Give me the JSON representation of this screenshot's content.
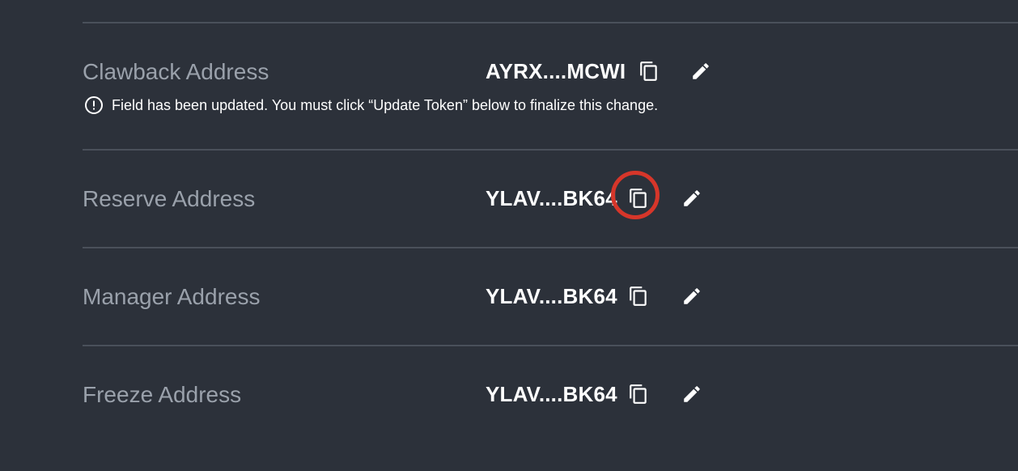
{
  "fields": [
    {
      "label": "Clawback Address",
      "value": "AYRX....MCWI",
      "copy_icon": "copy-icon",
      "edit_icon": "pencil-icon",
      "notice": "Field has been updated. You must click “Update Token” below to finalize this change."
    },
    {
      "label": "Reserve Address",
      "value": "YLAV....BK64",
      "copy_icon": "copy-icon",
      "edit_icon": "pencil-icon"
    },
    {
      "label": "Manager Address",
      "value": "YLAV....BK64",
      "copy_icon": "copy-icon",
      "edit_icon": "pencil-icon"
    },
    {
      "label": "Freeze Address",
      "value": "YLAV....BK64",
      "copy_icon": "copy-icon",
      "edit_icon": "pencil-icon"
    }
  ],
  "colors": {
    "background": "#2c313a",
    "label": "#9aa1ab",
    "value": "#ffffff",
    "divider": "#4a505a",
    "highlight": "#d6362a"
  }
}
